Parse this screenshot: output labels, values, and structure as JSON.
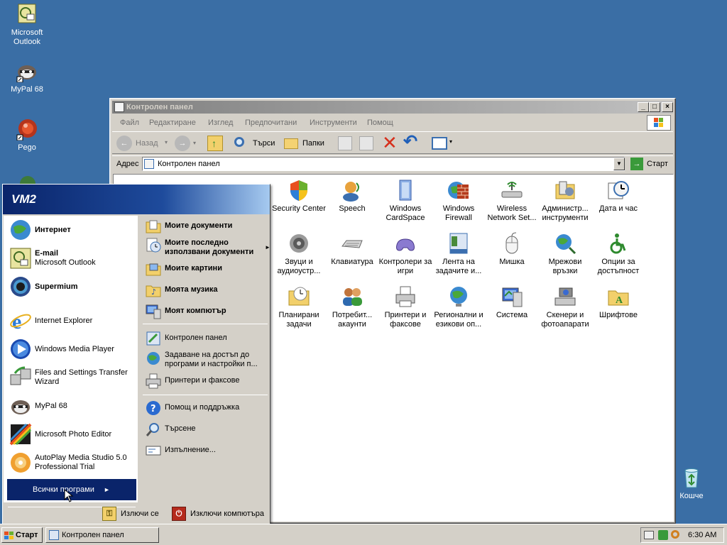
{
  "desktop": {
    "icons": [
      {
        "label": "Microsoft Outlook",
        "name": "outlook"
      },
      {
        "label": "MyPal 68",
        "name": "mypal"
      },
      {
        "label": "Pego",
        "name": "pego"
      },
      {
        "label": "Кошче",
        "name": "recycle-bin"
      }
    ]
  },
  "window": {
    "title": "Контролен панел",
    "menus": [
      "Файл",
      "Редактиране",
      "Изглед",
      "Предпочитани",
      "Инструменти",
      "Помощ"
    ],
    "toolbar": {
      "back": "Назад",
      "search": "Търси",
      "folders": "Папки"
    },
    "address": {
      "label": "Адрес",
      "value": "Контролен панел",
      "go": "Старт"
    },
    "items": [
      "Security Center",
      "Speech",
      "Windows CardSpace",
      "Windows Firewall",
      "Wireless Network Set...",
      "Администр... инструменти",
      "Дата и час",
      "Звуци и аудиоустр...",
      "Клавиатура",
      "Контролери за игри",
      "Лента на задачите и...",
      "Мишка",
      "Мрежови връзки",
      "Опции за достъпност",
      "Планирани задачи",
      "Потребит... акаунти",
      "Принтери и факсове",
      "Регионални и езикови оп...",
      "Система",
      "Скенери и фотоапарати",
      "Шрифтове"
    ]
  },
  "startmenu": {
    "user": "VM2",
    "pinned": [
      {
        "title": "Интернет",
        "sub": ""
      },
      {
        "title": "E-mail",
        "sub": "Microsoft Outlook"
      },
      {
        "title": "Supermium",
        "sub": ""
      }
    ],
    "recent": [
      "Internet Explorer",
      "Windows Media Player",
      "Files and Settings Transfer Wizard",
      "MyPal 68",
      "Microsoft Photo Editor",
      "AutoPlay Media Studio 5.0 Professional Trial"
    ],
    "all_programs": "Всички програми",
    "right": {
      "my_documents": "Моите документи",
      "recent_docs": "Моите последно използвани документи",
      "my_pictures": "Моите картини",
      "my_music": "Моята музика",
      "my_computer": "Моят компютър",
      "control_panel": "Контролен панел",
      "set_access": "Задаване на достъп до програми и настройки п...",
      "printers": "Принтери и факсове",
      "help": "Помощ и поддръжка",
      "search": "Търсене",
      "run": "Изпълнение..."
    },
    "logoff": "Излючи се",
    "shutdown": "Изключи компютъра"
  },
  "taskbar": {
    "start": "Старт",
    "task": "Контролен панел",
    "clock": "6:30 AM"
  }
}
